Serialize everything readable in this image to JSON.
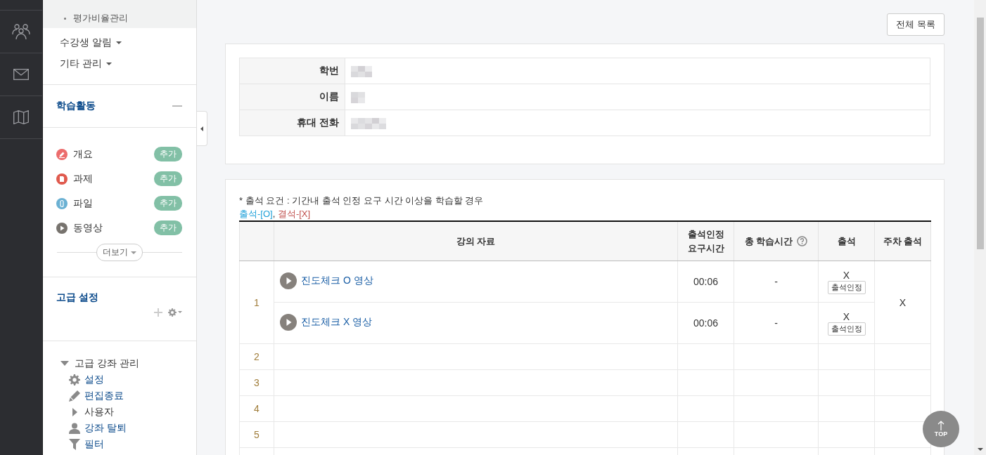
{
  "sidebar": {
    "submenu_items": [
      {
        "label": "평가비율관리"
      }
    ],
    "menus": [
      {
        "label": "수강생 알림"
      },
      {
        "label": "기타 관리"
      }
    ],
    "activities": {
      "title": "학습활동",
      "more": "더보기",
      "items": [
        {
          "label": "개요",
          "kind": "pencil",
          "color": "#ec6c6c",
          "add": "추가"
        },
        {
          "label": "과제",
          "kind": "document",
          "color": "#e05a4e",
          "add": "추가"
        },
        {
          "label": "파일",
          "kind": "clip",
          "color": "#6bb1d3",
          "add": "추가"
        },
        {
          "label": "동영상",
          "kind": "play",
          "color": "#77736e",
          "add": "추가"
        }
      ]
    },
    "advanced": {
      "title": "고급 설정",
      "tree": [
        {
          "label": "고급 강좌 관리",
          "kind": "node",
          "expanded": true,
          "children": [
            {
              "label": "설정",
              "kind": "gear"
            },
            {
              "label": "편집종료",
              "kind": "pencil"
            },
            {
              "label": "사용자",
              "kind": "node",
              "expanded": false
            },
            {
              "label": "강좌 탈퇴",
              "kind": "person"
            },
            {
              "label": "필터",
              "kind": "filter"
            }
          ]
        }
      ]
    }
  },
  "list_button": "전체 목록",
  "student": {
    "fields": [
      {
        "label": "학번"
      },
      {
        "label": "이름"
      },
      {
        "label": "휴대 전화"
      }
    ]
  },
  "attendance": {
    "note": "* 출석 요건 : 기간내 출석 인정 요구 시간 이상을 학습할 경우",
    "legend": [
      {
        "text": "출석-[O]",
        "color": "#1a9fd8"
      },
      {
        "text": "결석-[X]",
        "color": "#c0504d"
      }
    ],
    "legend_separator": ", ",
    "columns": [
      {
        "label": "강의 자료",
        "help": false
      },
      {
        "label": "출석인정 요구시간",
        "help": false
      },
      {
        "label": "총 학습시간",
        "help": true
      },
      {
        "label": "출석",
        "help": false
      },
      {
        "label": "주차 출석",
        "help": false
      }
    ],
    "weeks": [
      {
        "week": "1",
        "week_attendance": "X",
        "items": [
          {
            "title": "진도체크 O 영상",
            "required": "00:06",
            "total": "-",
            "attendance": "X",
            "approve": "출석인정"
          },
          {
            "title": "진도체크 X 영상",
            "required": "00:06",
            "total": "-",
            "attendance": "X",
            "approve": "출석인정"
          }
        ]
      },
      {
        "week": "2"
      },
      {
        "week": "3"
      },
      {
        "week": "4"
      },
      {
        "week": "5"
      }
    ]
  },
  "top_button": "TOP"
}
